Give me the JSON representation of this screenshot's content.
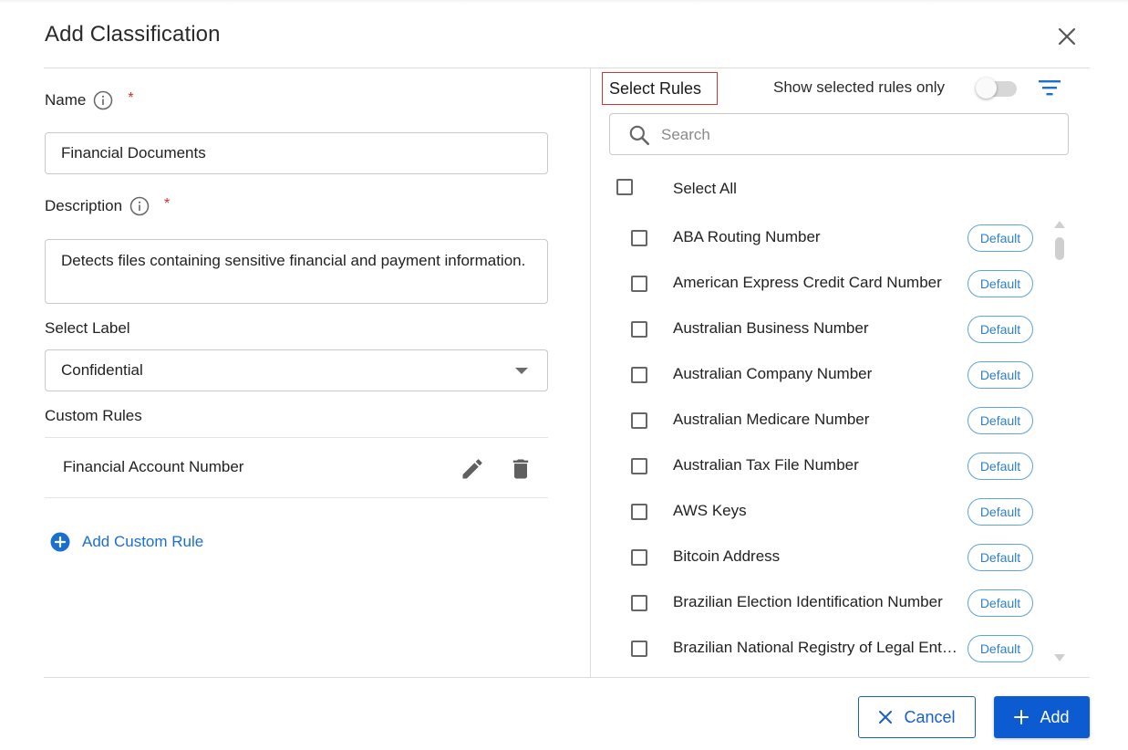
{
  "dialog": {
    "title": "Add Classification",
    "close_icon": "close-icon"
  },
  "form": {
    "name": {
      "label": "Name",
      "required_mark": "*",
      "value": "Financial Documents",
      "info_icon": "info-icon"
    },
    "description": {
      "label": "Description",
      "required_mark": "*",
      "value": "Detects files containing sensitive financial and payment information.",
      "info_icon": "info-icon"
    },
    "label_select": {
      "label": "Select Label",
      "value": "Confidential"
    },
    "custom_rules": {
      "label": "Custom Rules",
      "items": [
        {
          "name": "Financial Account Number",
          "edit_icon": "pencil-icon",
          "delete_icon": "trash-icon"
        }
      ],
      "add_label": "Add Custom Rule"
    }
  },
  "rules_panel": {
    "title": "Select Rules",
    "show_selected_label": "Show selected rules only",
    "show_selected_on": false,
    "filter_icon": "filter-icon",
    "search_placeholder": "Search",
    "select_all_label": "Select All",
    "items": [
      {
        "label": "ABA Routing Number",
        "badge": "Default",
        "checked": false
      },
      {
        "label": "American Express Credit Card Number",
        "badge": "Default",
        "checked": false
      },
      {
        "label": "Australian Business Number",
        "badge": "Default",
        "checked": false
      },
      {
        "label": "Australian Company Number",
        "badge": "Default",
        "checked": false
      },
      {
        "label": "Australian Medicare Number",
        "badge": "Default",
        "checked": false
      },
      {
        "label": "Australian Tax File Number",
        "badge": "Default",
        "checked": false
      },
      {
        "label": "AWS Keys",
        "badge": "Default",
        "checked": false
      },
      {
        "label": "Bitcoin Address",
        "badge": "Default",
        "checked": false
      },
      {
        "label": "Brazilian Election Identification Number",
        "badge": "Default",
        "checked": false
      },
      {
        "label": "Brazilian National Registry of Legal Entities",
        "badge": "Default",
        "checked": false
      }
    ]
  },
  "footer": {
    "cancel_label": "Cancel",
    "add_label": "Add"
  },
  "colors": {
    "primary": "#0d5bd1",
    "link": "#1a6fd0",
    "badge": "#2f7fc7",
    "required": "#d32f2f",
    "highlight_border": "#d33333"
  }
}
